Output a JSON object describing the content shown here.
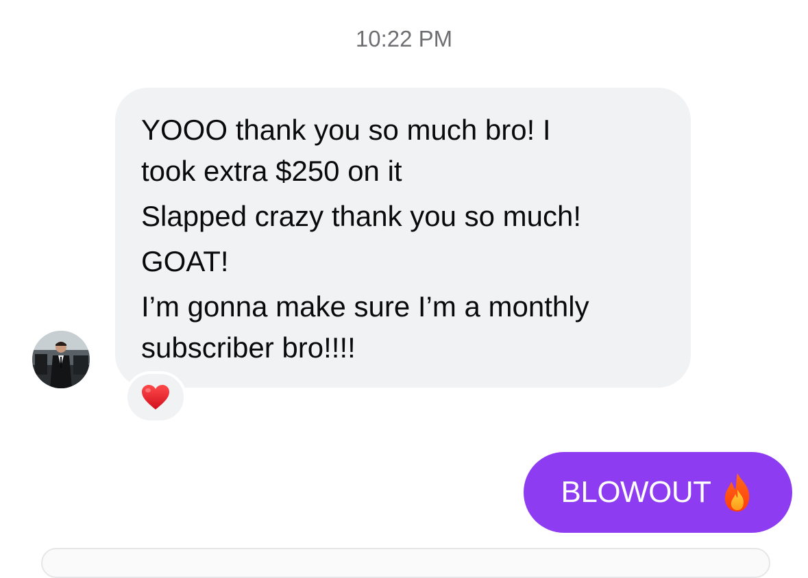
{
  "conversation": {
    "timestamp": "10:22 PM",
    "incoming_message": {
      "lines": [
        "YOOO thank you so much bro! I",
        "took extra $250 on it",
        "Slapped crazy thank you so much!",
        "GOAT!",
        "I’m gonna make sure I’m a monthly",
        "subscriber bro!!!!"
      ],
      "reaction_icon": "red-heart-icon",
      "bubble_color": "#f1f2f4"
    },
    "outgoing_message": {
      "text": "BLOWOUT",
      "emoji_icon": "fire-icon",
      "bubble_color": "#8d3cf1"
    }
  }
}
